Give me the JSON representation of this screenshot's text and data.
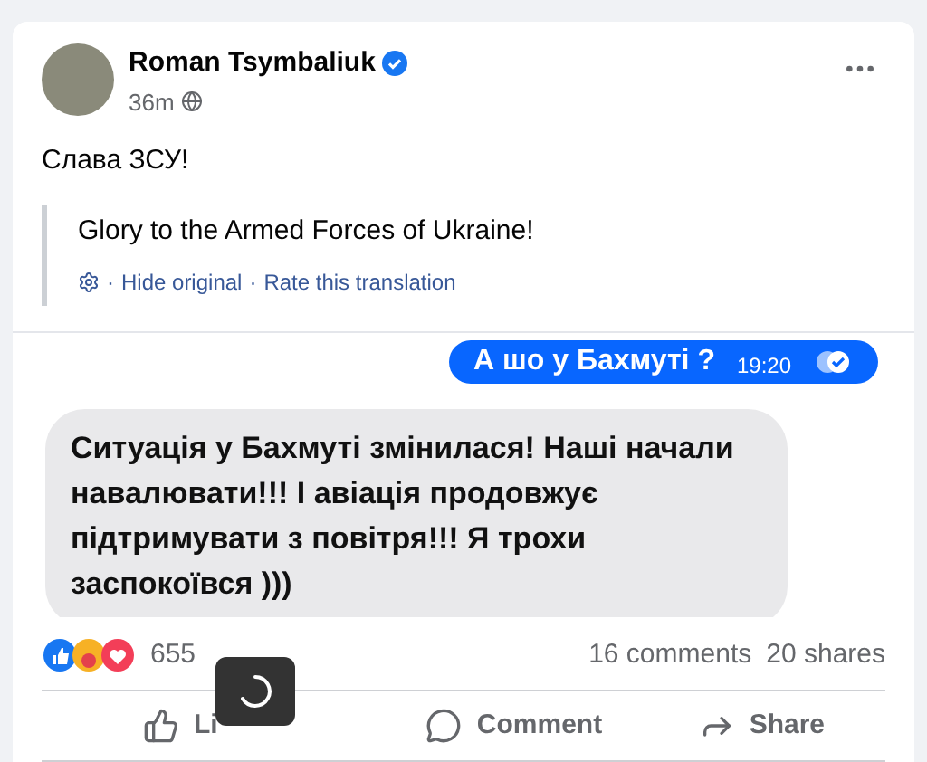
{
  "post": {
    "author": "Roman Tsymbaliuk",
    "verified": true,
    "time": "36m",
    "text": "Слава ЗСУ!",
    "translation": {
      "text": "Glory to the Armed Forces of Ukraine!",
      "separator": "·",
      "links": [
        "Hide original",
        "Rate this translation"
      ]
    }
  },
  "chat": {
    "messages": [
      {
        "kind": "sent",
        "text": "А шо у Бахмуті ?",
        "time": "19:20",
        "read": true
      },
      {
        "kind": "received",
        "text": "Ситуація у Бахмуті змінилася! Наші начали навалювати!!! І авіація продовжує підтримувати з повітря!!! Я трохи заспокоївся )))"
      }
    ]
  },
  "stats": {
    "reactions": "655",
    "comments": "16 comments",
    "shares": "20 shares"
  },
  "actions": [
    "Li",
    "Comment",
    "Share"
  ],
  "loading": true
}
